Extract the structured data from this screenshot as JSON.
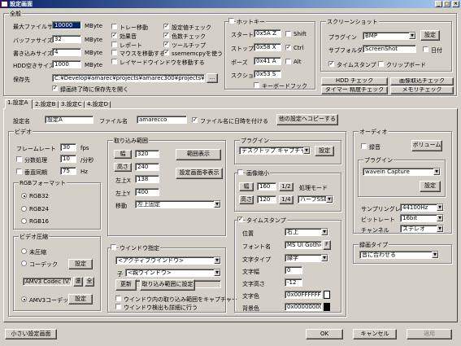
{
  "window": {
    "title": "設定画面",
    "min": "_",
    "max": "□",
    "close": "×"
  },
  "overall": {
    "legend": "全般",
    "max_file_size": {
      "label": "最大ファイルサイズ",
      "value": "10000",
      "unit": "MByte"
    },
    "buffer_size": {
      "label": "バッファサイズ",
      "value": "32",
      "unit": "MByte"
    },
    "write_size": {
      "label": "書き込みサイズ",
      "value": "4",
      "unit": "MByte"
    },
    "hdd_free": {
      "label": "HDD空きサイズ",
      "value": "1000",
      "unit": "MByte"
    },
    "save_to": {
      "label": "保存先",
      "value": "C:¥Develop¥amarec¥projects¥amarec300¥projects¥amarec¥",
      "btn": "..."
    },
    "open_folder": {
      "label": "録画終了時に保存先を開く",
      "checked": true
    },
    "checks_col1": [
      {
        "label": "トレー移動",
        "checked": false
      },
      {
        "label": "効果音",
        "checked": true
      },
      {
        "label": "レポート",
        "checked": false
      },
      {
        "label": "マウスを移動する",
        "checked": false
      },
      {
        "label": "レイヤードウインドウを移動する",
        "checked": false
      }
    ],
    "checks_col2": [
      {
        "label": "設定値チェック",
        "checked": true
      },
      {
        "label": "色数チェック",
        "checked": true
      },
      {
        "label": "ツールチップ",
        "checked": true
      },
      {
        "label": "ssememcpyを使う",
        "checked": true
      }
    ]
  },
  "hotkey": {
    "legend": "ホットキー",
    "enabled": false,
    "rows": [
      {
        "label": "スタート",
        "value": "0x5A Z",
        "mod": "Shift",
        "mod_checked": false
      },
      {
        "label": "ストップ",
        "value": "0x58 X",
        "mod": "Ctrl",
        "mod_checked": true
      },
      {
        "label": "ポーズ",
        "value": "0x41 A",
        "mod": "Alt",
        "mod_checked": false
      },
      {
        "label": "スクショット",
        "value": "0x53 S"
      }
    ],
    "keyboard_hook": {
      "label": "キーボードフック",
      "checked": false
    }
  },
  "screenshot": {
    "legend": "スクリーンショット",
    "plugin": {
      "label": "プラグイン",
      "value": "BMP",
      "btn": "設定"
    },
    "subfolder": {
      "label": "サブフォルダ",
      "value": "ScreenShot",
      "date_label": "日付",
      "date_checked": false
    },
    "timestamp": {
      "label": "タイムスタンプ",
      "checked": true
    },
    "clipboard": {
      "label": "クリップボード",
      "checked": false
    }
  },
  "tools": [
    "HDD チェック",
    "画像取込チェック",
    "タイマー 精度チェック",
    "メモリチェック"
  ],
  "tabs": [
    "1.設定A",
    "2.設定B",
    "3.設定C",
    "4.設定D"
  ],
  "setting": {
    "name_label": "設定名",
    "name_value": "設定A",
    "file_label": "ファイル名",
    "file_value": "amarecco",
    "date_label": "ファイル名に日時を付ける",
    "date_checked": true,
    "copy_btn": "他の設定へコピーする"
  },
  "video": {
    "legend": "ビデオ",
    "framerate": {
      "label": "フレームレート",
      "value": "30",
      "unit": "fps"
    },
    "split": {
      "label": "分数処理",
      "value": "10",
      "unit": "/分秒",
      "checked": false
    },
    "vsync": {
      "label": "垂直同期",
      "value": "75",
      "unit": "Hz",
      "checked": false
    },
    "rgb": {
      "legend": "RGBフォーマット",
      "options": [
        {
          "label": "RGB32",
          "selected": true
        },
        {
          "label": "RGB24",
          "selected": false
        },
        {
          "label": "RGB16",
          "selected": false
        }
      ]
    },
    "compress": {
      "legend": "ビデオ圧縮",
      "options": [
        {
          "label": "未圧縮",
          "selected": false
        },
        {
          "label": "コーデック",
          "selected": false
        },
        {
          "label": "AMV3コーデック",
          "selected": true
        }
      ],
      "codec_btn": "設定",
      "codec_value": "AMV3 Codec (V.V",
      "codec_b1": "還",
      "codec_b2": "全",
      "amv_btn": "設定"
    }
  },
  "capture": {
    "legend": "取り込み範囲",
    "width": {
      "label": "幅",
      "value": "320"
    },
    "height": {
      "label": "高さ",
      "value": "240"
    },
    "left": {
      "label": "左上X",
      "value": "138"
    },
    "top": {
      "label": "左上Y",
      "value": "400"
    },
    "move": {
      "label": "移動",
      "value": "左上固定"
    },
    "show_btn": "範囲表示",
    "hide_btn": "設定画面非表示"
  },
  "window_spec": {
    "legend": "ウインドウ指定",
    "checked": false,
    "active": "<アクティブウインドウ>",
    "child_label": "子",
    "child": "<親ウインドウ>",
    "update_btn": "更新",
    "set_btn": "取り込み範囲に設定",
    "opt1": {
      "label": "ウインドウ内の取り込み範囲をキャプチャー",
      "checked": false
    },
    "opt2": {
      "label": "ウインドウ検出も詳細に行う",
      "checked": false
    }
  },
  "vplugin": {
    "legend": "プラグイン",
    "value": "デスクトップ キャプチャー",
    "btn": "設定"
  },
  "shrink": {
    "legend": "画像縮小",
    "checked": false,
    "width_label": "幅",
    "width": "160",
    "w_ratio": "1/2",
    "height_label": "高さ",
    "height": "120",
    "h_ratio": "1/4",
    "mode_label": "処理モード",
    "mode": "ハーフSSE"
  },
  "timestamp": {
    "legend": "タイムスタンプ",
    "checked": true,
    "position": {
      "label": "位置",
      "value": "右上"
    },
    "font": {
      "label": "フォント名",
      "value": "MS UI Gothic",
      "btn": "F"
    },
    "type": {
      "label": "文字タイプ",
      "value": "縁字"
    },
    "width": {
      "label": "文字幅",
      "value": "0"
    },
    "height": {
      "label": "文字高さ",
      "value": "-12"
    },
    "color": {
      "label": "文字色",
      "value": "0x00FFFFFF",
      "swatch": "#ffffff"
    },
    "bgcolor": {
      "label": "背景色",
      "value": "0x00000000",
      "swatch": "#000000"
    }
  },
  "audio": {
    "legend": "オーディオ",
    "record": {
      "label": "録音",
      "checked": false
    },
    "volume_btn": "ボリューム",
    "plugin": {
      "legend": "プラグイン",
      "value": "wavein Capture",
      "btn": "設定"
    },
    "rate": {
      "label": "サンプリングレート",
      "value": "44100Hz"
    },
    "bits": {
      "label": "ビットレート",
      "value": "16bit"
    },
    "channel": {
      "label": "チャンネル",
      "value": "ステレオ"
    }
  },
  "rec_type": {
    "legend": "録画タイプ",
    "value": "音に合わせる"
  },
  "footer": {
    "small_btn": "小さい設定画面",
    "ok": "OK",
    "cancel": "キャンセル",
    "apply": "適用"
  }
}
